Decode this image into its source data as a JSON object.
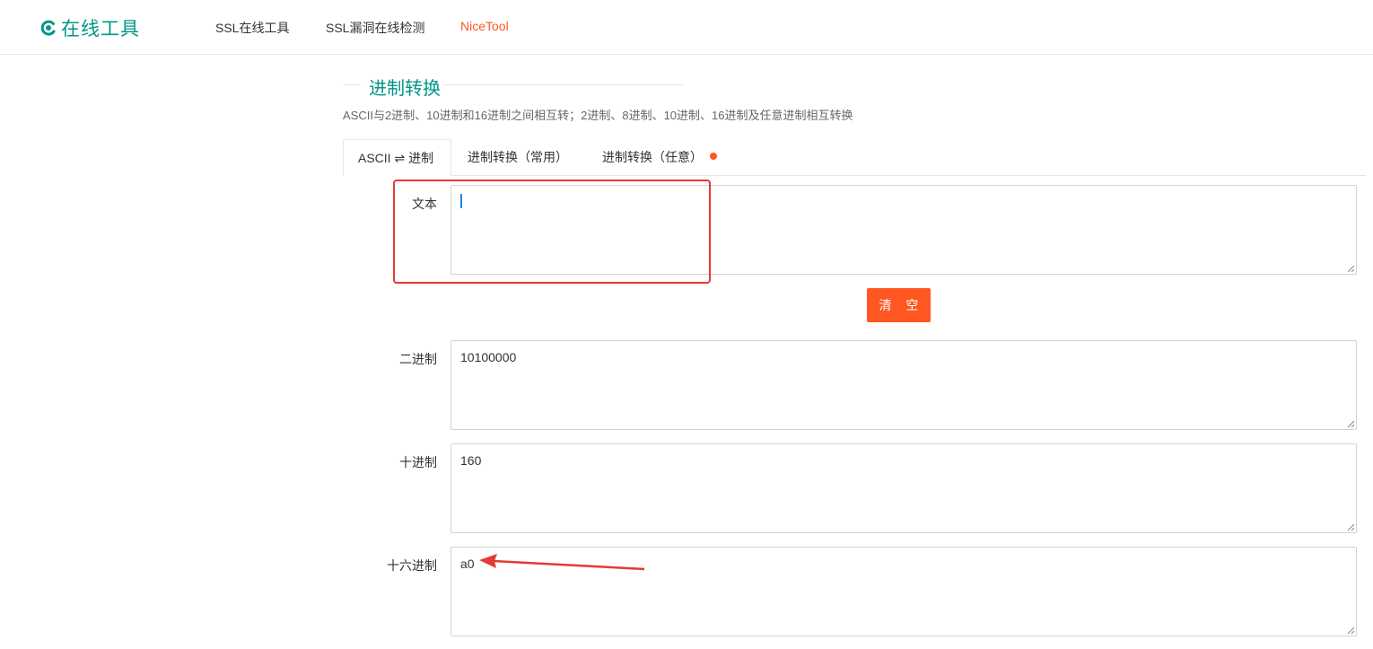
{
  "header": {
    "logo_text": "在线工具",
    "nav": [
      {
        "label": "SSL在线工具"
      },
      {
        "label": "SSL漏洞在线检测"
      },
      {
        "label": "NiceTool"
      }
    ]
  },
  "section": {
    "title": "进制转换",
    "description": "ASCII与2进制、10进制和16进制之间相互转；2进制、8进制、10进制、16进制及任意进制相互转换"
  },
  "tabs": [
    {
      "label": "ASCII ⇌ 进制",
      "active": true
    },
    {
      "label": "进制转换（常用）",
      "active": false
    },
    {
      "label": "进制转换（任意）",
      "active": false,
      "has_dot": true
    }
  ],
  "form": {
    "text": {
      "label": "文本",
      "value": ""
    },
    "clear_button": "清 空",
    "binary": {
      "label": "二进制",
      "value": "10100000"
    },
    "decimal": {
      "label": "十进制",
      "value": "160"
    },
    "hex": {
      "label": "十六进制",
      "value": "a0"
    }
  },
  "colors": {
    "brand": "#009688",
    "accent": "#ff5722",
    "annotation": "#e53935"
  }
}
